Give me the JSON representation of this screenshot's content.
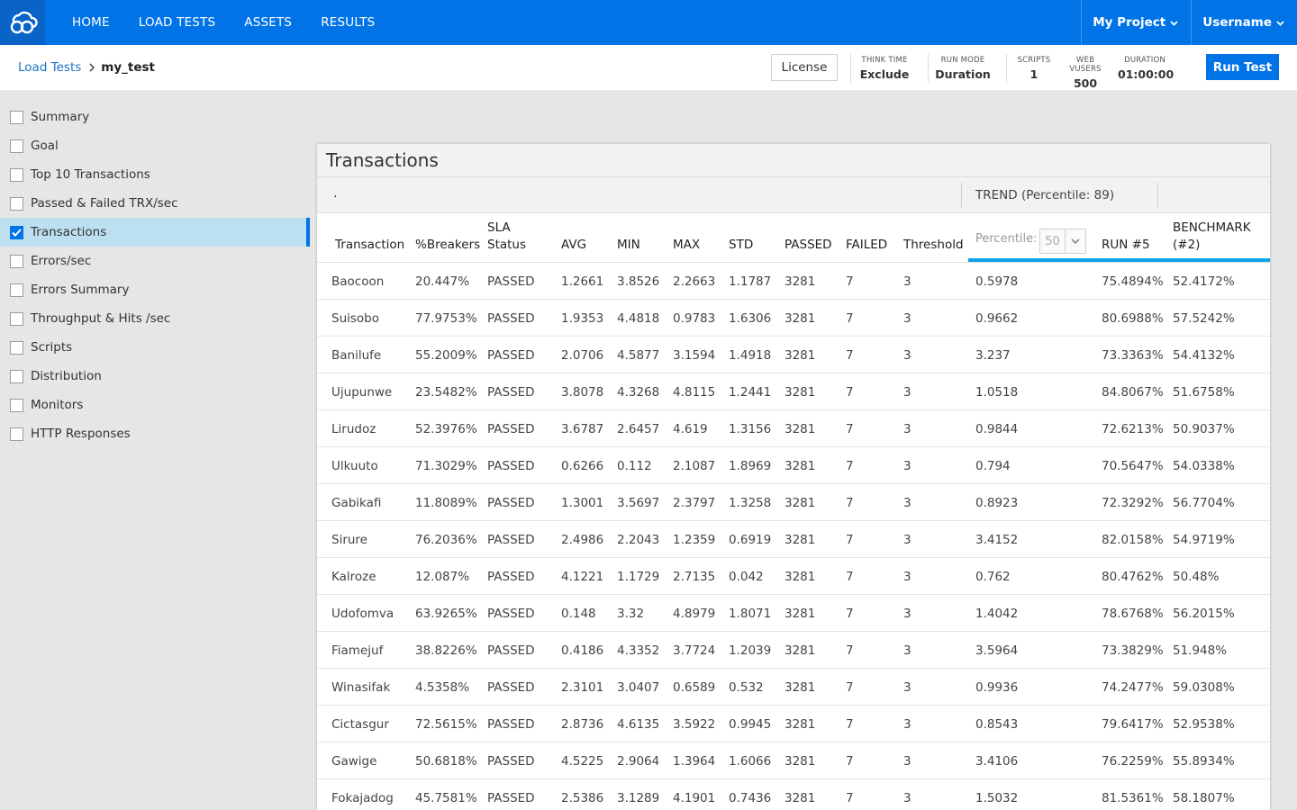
{
  "nav": {
    "items": [
      "HOME",
      "LOAD TESTS",
      "ASSETS",
      "RESULTS"
    ],
    "project": "My Project",
    "user": "Username"
  },
  "breadcrumb": {
    "parent": "Load Tests",
    "current": "my_test"
  },
  "header": {
    "license": "License",
    "stats": [
      {
        "label": "THINK TIME",
        "value": "Exclude"
      },
      {
        "label": "RUN MODE",
        "value": "Duration"
      },
      {
        "label": "SCRIPTS",
        "value": "1"
      },
      {
        "label": "WEB VUSERS",
        "value": "500"
      },
      {
        "label": "DURATION",
        "value": "01:00:00"
      }
    ],
    "run": "Run Test"
  },
  "sidebar": {
    "items": [
      {
        "label": "Summary",
        "checked": false
      },
      {
        "label": "Goal",
        "checked": false
      },
      {
        "label": "Top 10 Transactions",
        "checked": false
      },
      {
        "label": "Passed & Failed TRX/sec",
        "checked": false
      },
      {
        "label": "Transactions",
        "checked": true
      },
      {
        "label": "Errors/sec",
        "checked": false
      },
      {
        "label": "Errors Summary",
        "checked": false
      },
      {
        "label": "Throughput & Hits /sec",
        "checked": false
      },
      {
        "label": "Scripts",
        "checked": false
      },
      {
        "label": "Distribution",
        "checked": false
      },
      {
        "label": "Monitors",
        "checked": false
      },
      {
        "label": "HTTP Responses",
        "checked": false
      }
    ]
  },
  "panel": {
    "title": "Transactions",
    "group_dot": ".",
    "trend_group": "TREND (Percentile: 89)",
    "percentile_label": "Percentile:",
    "percentile_value": "50",
    "columns": {
      "transaction": "Transaction",
      "breakers": "%Breakers",
      "sla_1": "SLA",
      "sla_2": "Status",
      "avg": "AVG",
      "min": "MIN",
      "max": "MAX",
      "std": "STD",
      "passed": "PASSED",
      "failed": "FAILED",
      "threshold": "Threshold",
      "run": "RUN #5",
      "bench_1": "BENCHMARK",
      "bench_2": "(#2)"
    },
    "rows": [
      [
        "Baocoon",
        "20.447%",
        "PASSED",
        "1.2661",
        "3.8526",
        "2.2663",
        "1.1787",
        "3281",
        "7",
        "3",
        "0.5978",
        "75.4894%",
        "52.4172%"
      ],
      [
        "Suisobo",
        "77.9753%",
        "PASSED",
        "1.9353",
        "4.4818",
        "0.9783",
        "1.6306",
        "3281",
        "7",
        "3",
        "0.9662",
        "80.6988%",
        "57.5242%"
      ],
      [
        "Banilufe",
        "55.2009%",
        "PASSED",
        "2.0706",
        "4.5877",
        "3.1594",
        "1.4918",
        "3281",
        "7",
        "3",
        "3.237",
        "73.3363%",
        "54.4132%"
      ],
      [
        "Ujupunwe",
        "23.5482%",
        "PASSED",
        "3.8078",
        "4.3268",
        "4.8115",
        "1.2441",
        "3281",
        "7",
        "3",
        "1.0518",
        "84.8067%",
        "51.6758%"
      ],
      [
        "Lirudoz",
        "52.3976%",
        "PASSED",
        "3.6787",
        "2.6457",
        "4.619",
        "1.3156",
        "3281",
        "7",
        "3",
        "0.9844",
        "72.6213%",
        "50.9037%"
      ],
      [
        "Ulkuuto",
        "71.3029%",
        "PASSED",
        "0.6266",
        "0.112",
        "2.1087",
        "1.8969",
        "3281",
        "7",
        "3",
        "0.794",
        "70.5647%",
        "54.0338%"
      ],
      [
        "Gabikafi",
        "11.8089%",
        "PASSED",
        "1.3001",
        "3.5697",
        "2.3797",
        "1.3258",
        "3281",
        "7",
        "3",
        "0.8923",
        "72.3292%",
        "56.7704%"
      ],
      [
        "Sirure",
        "76.2036%",
        "PASSED",
        "2.4986",
        "2.2043",
        "1.2359",
        "0.6919",
        "3281",
        "7",
        "3",
        "3.4152",
        "82.0158%",
        "54.9719%"
      ],
      [
        "Kalroze",
        "12.087%",
        "PASSED",
        "4.1221",
        "1.1729",
        "2.7135",
        "0.042",
        "3281",
        "7",
        "3",
        "0.762",
        "80.4762%",
        "50.48%"
      ],
      [
        "Udofomva",
        "63.9265%",
        "PASSED",
        "0.148",
        "3.32",
        "4.8979",
        "1.8071",
        "3281",
        "7",
        "3",
        "1.4042",
        "78.6768%",
        "56.2015%"
      ],
      [
        "Fiamejuf",
        "38.8226%",
        "PASSED",
        "0.4186",
        "4.3352",
        "3.7724",
        "1.2039",
        "3281",
        "7",
        "3",
        "3.5964",
        "73.3829%",
        "51.948%"
      ],
      [
        "Winasifak",
        "4.5358%",
        "PASSED",
        "2.3101",
        "3.0407",
        "0.6589",
        "0.532",
        "3281",
        "7",
        "3",
        "0.9936",
        "74.2477%",
        "59.0308%"
      ],
      [
        "Cictasgur",
        "72.5615%",
        "PASSED",
        "2.8736",
        "4.6135",
        "3.5922",
        "0.9945",
        "3281",
        "7",
        "3",
        "0.8543",
        "79.6417%",
        "52.9538%"
      ],
      [
        "Gawige",
        "50.6818%",
        "PASSED",
        "4.5225",
        "2.9064",
        "1.3964",
        "1.6066",
        "3281",
        "7",
        "3",
        "3.4106",
        "76.2259%",
        "55.8934%"
      ],
      [
        "Fokajadog",
        "45.7581%",
        "PASSED",
        "2.5386",
        "3.1289",
        "4.1901",
        "0.7436",
        "3281",
        "7",
        "3",
        "1.5032",
        "81.5361%",
        "58.1807%"
      ]
    ]
  }
}
